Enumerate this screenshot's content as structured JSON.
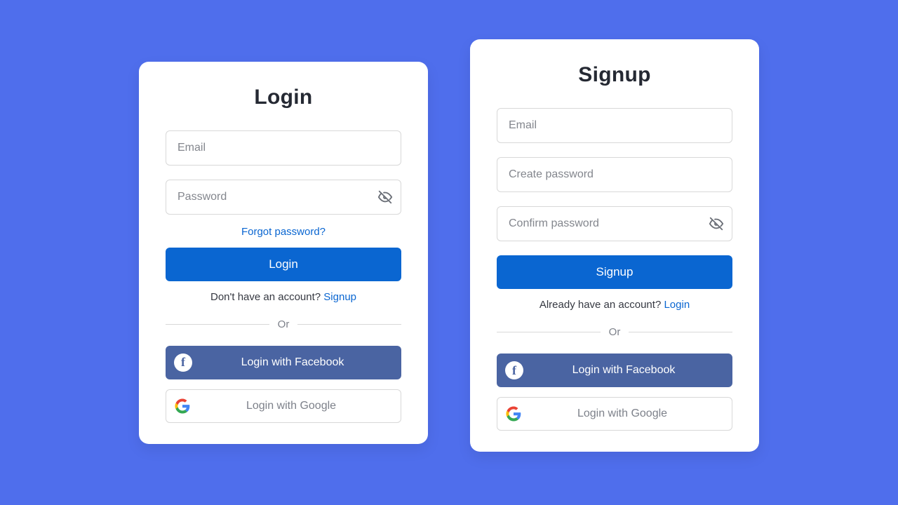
{
  "login": {
    "title": "Login",
    "email_placeholder": "Email",
    "password_placeholder": "Password",
    "forgot": "Forgot password?",
    "submit": "Login",
    "switch_text": "Don't have an account? ",
    "switch_link": "Signup",
    "or": "Or",
    "facebook": "Login with Facebook",
    "google": "Login with Google"
  },
  "signup": {
    "title": "Signup",
    "email_placeholder": "Email",
    "create_password_placeholder": "Create password",
    "confirm_password_placeholder": "Confirm password",
    "submit": "Signup",
    "switch_text": "Already have an account? ",
    "switch_link": "Login",
    "or": "Or",
    "facebook": "Login with Facebook",
    "google": "Login with Google"
  }
}
